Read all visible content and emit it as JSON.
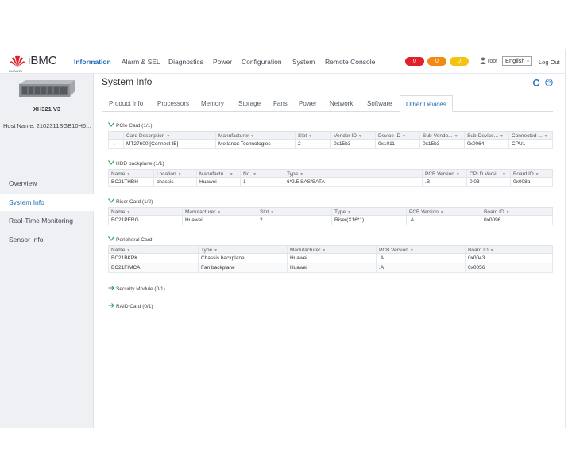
{
  "header": {
    "brand": "iBMC",
    "logo_caption": "HUAWEI",
    "nav": [
      "Information",
      "Alarm & SEL",
      "Diagnostics",
      "Power",
      "Configuration",
      "System",
      "Remote Console"
    ],
    "alerts": [
      {
        "count": "0",
        "color": "#e0202b"
      },
      {
        "count": "0",
        "color": "#f08a12"
      },
      {
        "count": "0",
        "color": "#f3c311"
      }
    ],
    "user": "root",
    "language": "English",
    "logout": "Log Out"
  },
  "sidebar": {
    "model": "XH321 V3",
    "hostname": "Host Name: 2102311SGB10H6...",
    "items": [
      "Overview",
      "System Info",
      "Real-Time Monitoring",
      "Sensor Info"
    ]
  },
  "page": {
    "title": "System Info",
    "tabs": [
      "Product Info",
      "Processors",
      "Memory",
      "Storage",
      "Fans",
      "Power",
      "Network",
      "Software",
      "Other Devices"
    ]
  },
  "pcie": {
    "title": "PCIe Card (1/1)",
    "headers": [
      "Card Description",
      "Manufacturer",
      "Slot",
      "Vendor ID",
      "Device ID",
      "Sub-Vendo...",
      "Sub-Device...",
      "Connected ..."
    ],
    "rows": [
      [
        "MT27600 [Connect-IB]",
        "Mellanox Technologies",
        "2",
        "0x15b3",
        "0x1011",
        "0x15b3",
        "0x0064",
        "CPU1"
      ]
    ]
  },
  "hdd": {
    "title": "HDD backplane (1/1)",
    "headers": [
      "Name",
      "Location",
      "Manufactu...",
      "No.",
      "Type",
      "PCB Version",
      "CPLD Versi...",
      "Board ID"
    ],
    "rows": [
      [
        "BC21THBH",
        "chassis",
        "Huawei",
        "1",
        "6*2.5 SAS/SATA",
        ".B",
        "0.03",
        "0x008a"
      ]
    ]
  },
  "riser": {
    "title": "Riser Card (1/2)",
    "headers": [
      "Name",
      "Manufacturer",
      "Slot",
      "Type",
      "PCB Version",
      "Board ID"
    ],
    "rows": [
      [
        "BC21PERG",
        "Huawei",
        "2",
        "Riser(X16*1)",
        ".A",
        "0x0096"
      ]
    ]
  },
  "peripheral": {
    "title": "Peripheral Card",
    "headers": [
      "Name",
      "Type",
      "Manufacturer",
      "PCB Version",
      "Board ID"
    ],
    "rows": [
      [
        "BC21BKPK",
        "Chassis backplane",
        "Huawei",
        ".A",
        "0x0043"
      ],
      [
        "BC21FIMCA",
        "Fan backplane",
        "Huawei",
        ".A",
        "0x0056"
      ]
    ]
  },
  "security": {
    "title": "Security Module (0/1)"
  },
  "raid": {
    "title": "RAID Card (0/1)"
  }
}
